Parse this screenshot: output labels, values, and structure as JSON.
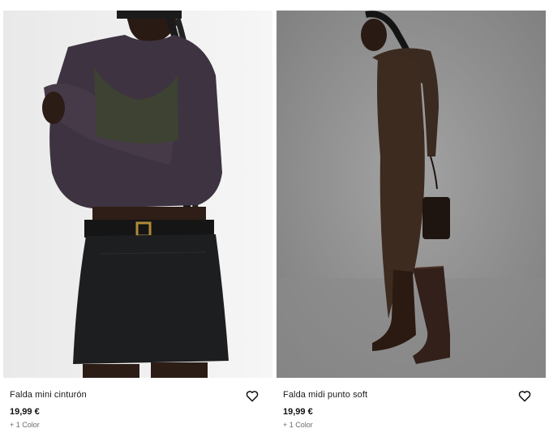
{
  "products": [
    {
      "name": "Falda mini cinturón",
      "price": "19,99 €",
      "colors": "+ 1 Color",
      "image_alt": "Falda mini cinturón",
      "favorite_icon": "heart-outline-icon"
    },
    {
      "name": "Falda midi punto soft",
      "price": "19,99 €",
      "colors": "+ 1 Color",
      "image_alt": "Falda midi punto soft",
      "favorite_icon": "heart-outline-icon"
    }
  ],
  "colors": {
    "text": "#1a1a1a",
    "muted": "#6b6b6b",
    "left_bg": "#eeeeee",
    "right_bg": "#8d8d8d"
  }
}
